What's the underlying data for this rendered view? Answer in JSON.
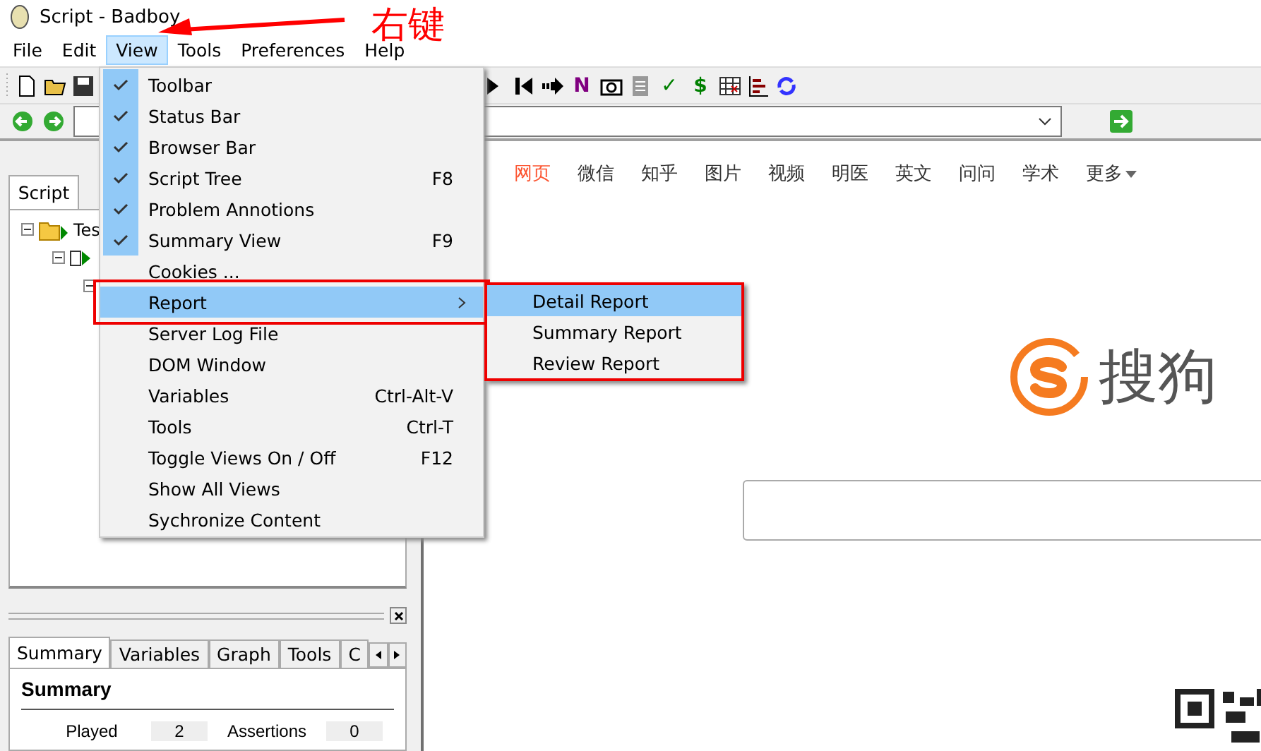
{
  "window": {
    "title": "Script - Badboy"
  },
  "menu_bar": [
    {
      "label": "File",
      "selected": false
    },
    {
      "label": "Edit",
      "selected": false
    },
    {
      "label": "View",
      "selected": true
    },
    {
      "label": "Tools",
      "selected": false
    },
    {
      "label": "Preferences",
      "selected": false
    },
    {
      "label": "Help",
      "selected": false
    }
  ],
  "toolbar_left": [
    {
      "kind": "new"
    },
    {
      "kind": "open"
    },
    {
      "kind": "save"
    }
  ],
  "toolbar_right": [
    {
      "kind": "play"
    },
    {
      "kind": "skip-back"
    },
    {
      "kind": "forward"
    },
    {
      "kind": "glyph",
      "text": "N",
      "color": "#800080"
    },
    {
      "kind": "camera"
    },
    {
      "kind": "page"
    },
    {
      "kind": "glyph",
      "text": "✓",
      "color": "#008000"
    },
    {
      "kind": "glyph",
      "text": "$",
      "color": "#008000"
    },
    {
      "kind": "table"
    },
    {
      "kind": "bars"
    },
    {
      "kind": "refresh"
    }
  ],
  "view_menu": [
    {
      "label": "Toolbar",
      "checked": true,
      "selected": false,
      "has_submenu": false
    },
    {
      "label": "Status Bar",
      "checked": true,
      "selected": false,
      "has_submenu": false
    },
    {
      "label": "Browser Bar",
      "checked": true,
      "selected": false,
      "has_submenu": false
    },
    {
      "label": "Script Tree",
      "checked": true,
      "selected": false,
      "has_submenu": false,
      "shortcut": "F8"
    },
    {
      "label": "Problem Annotions",
      "checked": true,
      "selected": false,
      "has_submenu": false
    },
    {
      "label": "Summary View",
      "checked": true,
      "selected": false,
      "has_submenu": false,
      "shortcut": "F9"
    },
    {
      "label": "Cookies ...",
      "checked": false,
      "selected": false,
      "has_submenu": false
    },
    {
      "label": "Report",
      "checked": false,
      "selected": true,
      "has_submenu": true
    },
    {
      "label": "Server Log File",
      "checked": false,
      "selected": false,
      "has_submenu": false
    },
    {
      "label": "DOM Window",
      "checked": false,
      "selected": false,
      "has_submenu": false
    },
    {
      "label": "Variables",
      "checked": false,
      "selected": false,
      "has_submenu": false,
      "shortcut": "Ctrl-Alt-V"
    },
    {
      "label": "Tools",
      "checked": false,
      "selected": false,
      "has_submenu": false,
      "shortcut": "Ctrl-T"
    },
    {
      "label": "Toggle Views On / Off",
      "checked": false,
      "selected": false,
      "has_submenu": false,
      "shortcut": "F12"
    },
    {
      "label": "Show All Views",
      "checked": false,
      "selected": false,
      "has_submenu": false
    },
    {
      "label": "Sychronize Content",
      "checked": false,
      "selected": false,
      "has_submenu": false
    }
  ],
  "report_submenu": [
    {
      "label": "Detail Report",
      "selected": true
    },
    {
      "label": "Summary Report",
      "selected": false
    },
    {
      "label": "Review Report",
      "selected": false
    }
  ],
  "annotation": {
    "text": "右键"
  },
  "script_panel": {
    "tab": "Script",
    "tree": [
      {
        "label": "Tes",
        "expanded": true,
        "children": [
          {
            "expanded": true,
            "children": [
              {
                "expanded": true
              }
            ]
          }
        ]
      }
    ]
  },
  "bottom_tabs": [
    {
      "label": "Summary",
      "selected": true
    },
    {
      "label": "Variables",
      "selected": false
    },
    {
      "label": "Graph",
      "selected": false
    },
    {
      "label": "Tools",
      "selected": false
    },
    {
      "label": "C",
      "selected": false
    }
  ],
  "summary": {
    "heading": "Summary",
    "stats": [
      {
        "label": "Played",
        "value": "2"
      },
      {
        "label": "Assertions",
        "value": "0"
      }
    ]
  },
  "browser": {
    "nav": [
      {
        "label": "网页",
        "selected": true,
        "dropdown": false
      },
      {
        "label": "微信",
        "selected": false,
        "dropdown": false
      },
      {
        "label": "知乎",
        "selected": false,
        "dropdown": false
      },
      {
        "label": "图片",
        "selected": false,
        "dropdown": false
      },
      {
        "label": "视频",
        "selected": false,
        "dropdown": false
      },
      {
        "label": "明医",
        "selected": false,
        "dropdown": false
      },
      {
        "label": "英文",
        "selected": false,
        "dropdown": false
      },
      {
        "label": "问问",
        "selected": false,
        "dropdown": false
      },
      {
        "label": "学术",
        "selected": false,
        "dropdown": false
      },
      {
        "label": "更多",
        "selected": false,
        "dropdown": true
      }
    ],
    "logo_text": "搜狗"
  }
}
